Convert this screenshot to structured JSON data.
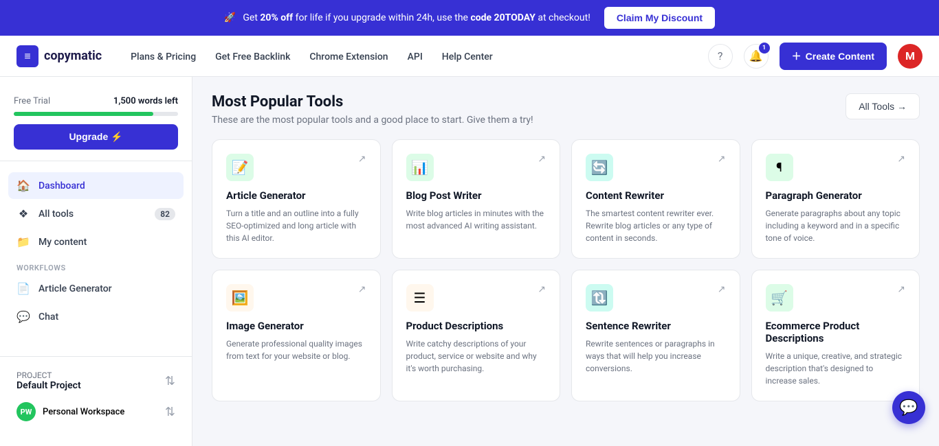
{
  "banner": {
    "icon": "🚀",
    "text_before_bold": "Get ",
    "bold_text": "20% off",
    "text_after": " for life if you upgrade within 24h, use the ",
    "code_label": "code 20TODAY",
    "text_end": " at checkout!",
    "button_label": "Claim My Discount"
  },
  "navbar": {
    "logo_text": "copymatic",
    "links": [
      {
        "label": "Plans & Pricing",
        "href": "#"
      },
      {
        "label": "Get Free Backlink",
        "href": "#"
      },
      {
        "label": "Chrome Extension",
        "href": "#"
      },
      {
        "label": "API",
        "href": "#"
      },
      {
        "label": "Help Center",
        "href": "#"
      }
    ],
    "notification_count": "1",
    "create_button_label": "Create Content",
    "avatar_letter": "M"
  },
  "sidebar": {
    "trial_label": "Free Trial",
    "words_left": "1,500 words left",
    "progress_percent": 85,
    "upgrade_label": "Upgrade ⚡",
    "nav_items": [
      {
        "id": "dashboard",
        "label": "Dashboard",
        "icon": "🏠",
        "active": true
      },
      {
        "id": "all-tools",
        "label": "All tools",
        "icon": "⊕",
        "badge": "82"
      },
      {
        "id": "my-content",
        "label": "My content",
        "icon": "📁"
      }
    ],
    "section_label": "Workflows",
    "workflow_items": [
      {
        "id": "article-generator",
        "label": "Article Generator",
        "icon": "📄"
      },
      {
        "id": "chat",
        "label": "Chat",
        "icon": "💬"
      }
    ],
    "project_label": "PROJECT",
    "project_name": "Default Project",
    "workspace_initials": "PW",
    "workspace_name": "Personal Workspace"
  },
  "main": {
    "title": "Most Popular Tools",
    "subtitle": "These are the most popular tools and a good place to start. Give them a try!",
    "all_tools_label": "All Tools →",
    "tools": [
      {
        "id": "article-generator",
        "icon": "📝",
        "icon_class": "green",
        "title": "Article Generator",
        "desc": "Turn a title and an outline into a fully SEO-optimized and long article with this AI editor."
      },
      {
        "id": "blog-post-writer",
        "icon": "📊",
        "icon_class": "green",
        "title": "Blog Post Writer",
        "desc": "Write blog articles in minutes with the most advanced AI writing assistant."
      },
      {
        "id": "content-rewriter",
        "icon": "🔄",
        "icon_class": "teal",
        "title": "Content Rewriter",
        "desc": "The smartest content rewriter ever. Rewrite blog articles or any type of content in seconds."
      },
      {
        "id": "paragraph-generator",
        "icon": "¶",
        "icon_class": "green",
        "title": "Paragraph Generator",
        "desc": "Generate paragraphs about any topic including a keyword and in a specific tone of voice."
      },
      {
        "id": "image-generator",
        "icon": "🖼️",
        "icon_class": "orange",
        "title": "Image Generator",
        "desc": "Generate professional quality images from text for your website or blog."
      },
      {
        "id": "product-descriptions",
        "icon": "☰",
        "icon_class": "orange",
        "title": "Product Descriptions",
        "desc": "Write catchy descriptions of your product, service or website and why it's worth purchasing."
      },
      {
        "id": "sentence-rewriter",
        "icon": "🔃",
        "icon_class": "teal",
        "title": "Sentence Rewriter",
        "desc": "Rewrite sentences or paragraphs in ways that will help you increase conversions."
      },
      {
        "id": "ecommerce-product-descriptions",
        "icon": "🛒",
        "icon_class": "green",
        "title": "Ecommerce Product Descriptions",
        "desc": "Write a unique, creative, and strategic description that's designed to increase sales."
      }
    ]
  }
}
